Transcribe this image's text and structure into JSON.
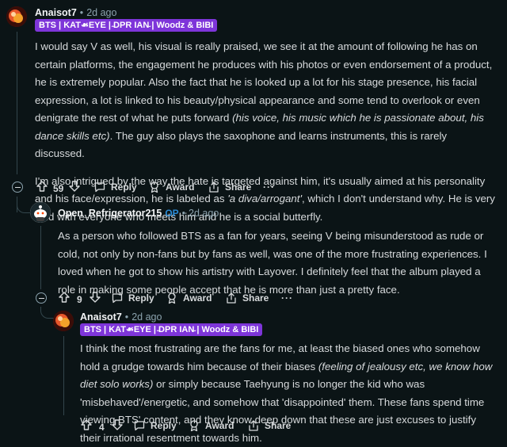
{
  "comment1": {
    "username": "Anaisot7",
    "time": "2d ago",
    "flair": "BTS | KAT☙EYE | ̴DPR IAN̴ | Woodz & BIBI",
    "paragraph1_a": "I would say V as well, his visual is really praised, we see it at the amount of following he has on certain platforms, the engagement he produces with his photos or even endorsement of a product, he is extremely popular. Also the fact that he is looked up a lot for his stage presence, his facial expression, a lot is linked to his beauty/physical appearance and some tend to overlook or even denigrate the rest of what he puts forward ",
    "paragraph1_italic": "(his voice, his music which he is passionate about, his dance skills etc)",
    "paragraph1_b": ". The guy also plays the saxophone and learns instruments, this is rarely discussed.",
    "paragraph2_a": "I'm also intrigued by the way the hate is targeted against him, it's usually aimed at his personality and his face/expression, he is labeled as ",
    "paragraph2_italic": "'a diva/arrogant'",
    "paragraph2_b": ", which I don't understand why. He is very kind with everyone who meets him and he is a social butterfly.",
    "votes": "59",
    "reply_label": "Reply",
    "award_label": "Award",
    "share_label": "Share",
    "more_label": "···"
  },
  "comment2": {
    "username": "Open_Refrigerator215",
    "op_badge": "OP",
    "time": "2d ago",
    "paragraph": "As a person who followed BTS as a fan for years, seeing V being misunderstood as rude or cold, not only by non-fans but by fans as well, was one of the more frustrating experiences. I loved when he got to show his artistry with Layover. I definitely feel that the album played a role in making some people accept that he is more than just a pretty face.",
    "votes": "9",
    "reply_label": "Reply",
    "award_label": "Award",
    "share_label": "Share",
    "more_label": "···"
  },
  "comment3": {
    "username": "Anaisot7",
    "time": "2d ago",
    "flair": "BTS | KAT☙EYE | ̴DPR IAN̴ | Woodz & BIBI",
    "paragraph_a": "I think the most frustrating are the fans for me, at least the biased ones who somehow hold a grudge towards him because of their biases ",
    "paragraph_italic": "(feeling of jealousy etc, we know how diet solo works)",
    "paragraph_b": " or simply because Taehyung is no longer the kid who was 'misbehaved'/energetic, and somehow that 'disappointed' them. These fans spend time viewing BTS' content, and they know deep down that these are just excuses to justify their irrational resentment towards him.",
    "votes": "4",
    "reply_label": "Reply",
    "award_label": "Award",
    "share_label": "Share"
  },
  "colors": {
    "background": "#0b1416",
    "flair": "#7e35d9",
    "op": "#2b8cd6",
    "meta": "#8ba2ad"
  }
}
